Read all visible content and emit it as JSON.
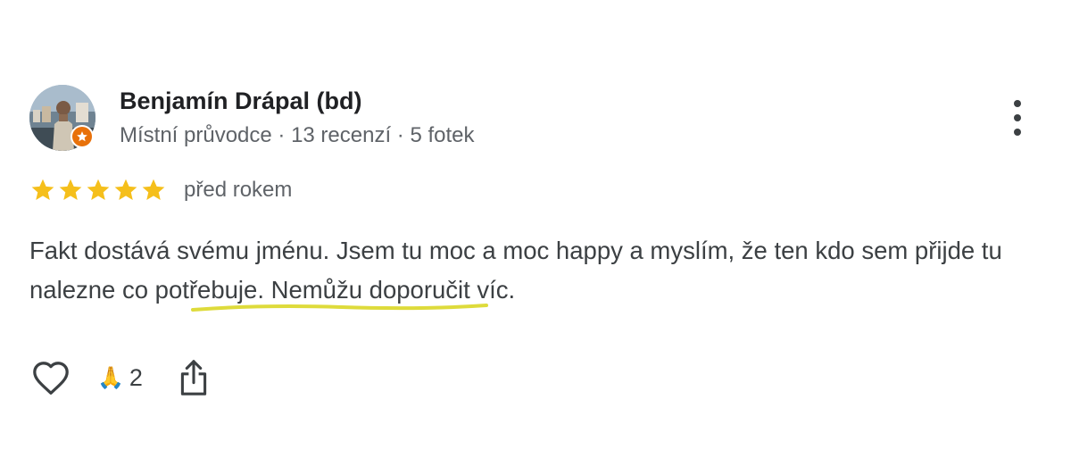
{
  "review": {
    "author": {
      "name": "Benjamín Drápal (bd)",
      "meta": "Místní průvodce · 13 recenzí · 5 fotek"
    },
    "rating": 5,
    "rating_max": 5,
    "date": "před rokem",
    "text": "Fakt dostává svému jménu. Jsem tu moc a moc happy a myslím, že ten kdo sem přijde tu nalezne co potřebuje. Nemůžu doporučit víc.",
    "highlighted_phrase": "nalezne co potřebuje.",
    "reactions": {
      "emoji": "🙏",
      "count": "2"
    }
  },
  "icons": {
    "more": "more-vert-icon",
    "like": "heart-outline-icon",
    "share": "share-icon",
    "star": "star-icon",
    "badge": "local-guide-badge-icon"
  },
  "colors": {
    "star": "#f5bf1b",
    "badge": "#e8710a",
    "highlight_underline": "#dedb3b",
    "text_primary": "#202124",
    "text_secondary": "#5f6368"
  }
}
